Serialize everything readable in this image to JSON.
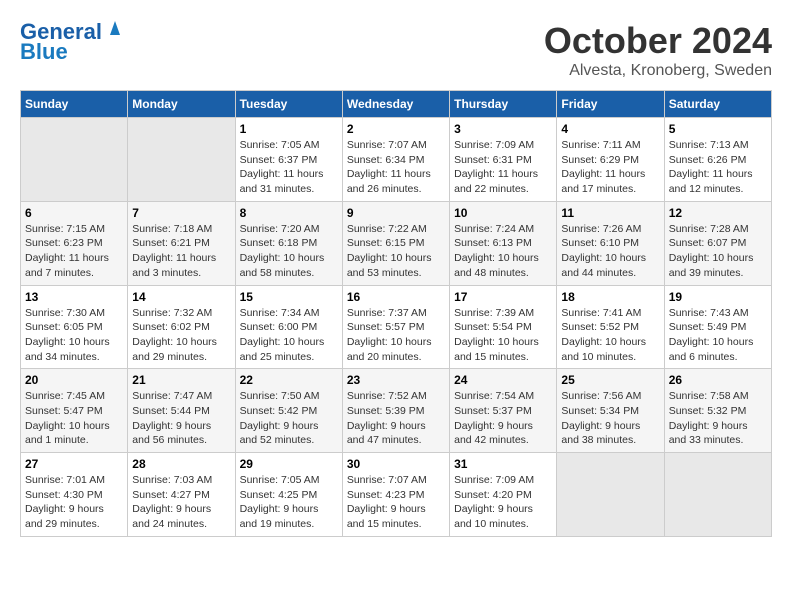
{
  "header": {
    "logo_line1": "General",
    "logo_line2": "Blue",
    "month": "October 2024",
    "location": "Alvesta, Kronoberg, Sweden"
  },
  "weekdays": [
    "Sunday",
    "Monday",
    "Tuesday",
    "Wednesday",
    "Thursday",
    "Friday",
    "Saturday"
  ],
  "weeks": [
    [
      null,
      null,
      {
        "day": 1,
        "sunrise": "7:05 AM",
        "sunset": "6:37 PM",
        "daylight": "11 hours and 31 minutes."
      },
      {
        "day": 2,
        "sunrise": "7:07 AM",
        "sunset": "6:34 PM",
        "daylight": "11 hours and 26 minutes."
      },
      {
        "day": 3,
        "sunrise": "7:09 AM",
        "sunset": "6:31 PM",
        "daylight": "11 hours and 22 minutes."
      },
      {
        "day": 4,
        "sunrise": "7:11 AM",
        "sunset": "6:29 PM",
        "daylight": "11 hours and 17 minutes."
      },
      {
        "day": 5,
        "sunrise": "7:13 AM",
        "sunset": "6:26 PM",
        "daylight": "11 hours and 12 minutes."
      }
    ],
    [
      {
        "day": 6,
        "sunrise": "7:15 AM",
        "sunset": "6:23 PM",
        "daylight": "11 hours and 7 minutes."
      },
      {
        "day": 7,
        "sunrise": "7:18 AM",
        "sunset": "6:21 PM",
        "daylight": "11 hours and 3 minutes."
      },
      {
        "day": 8,
        "sunrise": "7:20 AM",
        "sunset": "6:18 PM",
        "daylight": "10 hours and 58 minutes."
      },
      {
        "day": 9,
        "sunrise": "7:22 AM",
        "sunset": "6:15 PM",
        "daylight": "10 hours and 53 minutes."
      },
      {
        "day": 10,
        "sunrise": "7:24 AM",
        "sunset": "6:13 PM",
        "daylight": "10 hours and 48 minutes."
      },
      {
        "day": 11,
        "sunrise": "7:26 AM",
        "sunset": "6:10 PM",
        "daylight": "10 hours and 44 minutes."
      },
      {
        "day": 12,
        "sunrise": "7:28 AM",
        "sunset": "6:07 PM",
        "daylight": "10 hours and 39 minutes."
      }
    ],
    [
      {
        "day": 13,
        "sunrise": "7:30 AM",
        "sunset": "6:05 PM",
        "daylight": "10 hours and 34 minutes."
      },
      {
        "day": 14,
        "sunrise": "7:32 AM",
        "sunset": "6:02 PM",
        "daylight": "10 hours and 29 minutes."
      },
      {
        "day": 15,
        "sunrise": "7:34 AM",
        "sunset": "6:00 PM",
        "daylight": "10 hours and 25 minutes."
      },
      {
        "day": 16,
        "sunrise": "7:37 AM",
        "sunset": "5:57 PM",
        "daylight": "10 hours and 20 minutes."
      },
      {
        "day": 17,
        "sunrise": "7:39 AM",
        "sunset": "5:54 PM",
        "daylight": "10 hours and 15 minutes."
      },
      {
        "day": 18,
        "sunrise": "7:41 AM",
        "sunset": "5:52 PM",
        "daylight": "10 hours and 10 minutes."
      },
      {
        "day": 19,
        "sunrise": "7:43 AM",
        "sunset": "5:49 PM",
        "daylight": "10 hours and 6 minutes."
      }
    ],
    [
      {
        "day": 20,
        "sunrise": "7:45 AM",
        "sunset": "5:47 PM",
        "daylight": "10 hours and 1 minute."
      },
      {
        "day": 21,
        "sunrise": "7:47 AM",
        "sunset": "5:44 PM",
        "daylight": "9 hours and 56 minutes."
      },
      {
        "day": 22,
        "sunrise": "7:50 AM",
        "sunset": "5:42 PM",
        "daylight": "9 hours and 52 minutes."
      },
      {
        "day": 23,
        "sunrise": "7:52 AM",
        "sunset": "5:39 PM",
        "daylight": "9 hours and 47 minutes."
      },
      {
        "day": 24,
        "sunrise": "7:54 AM",
        "sunset": "5:37 PM",
        "daylight": "9 hours and 42 minutes."
      },
      {
        "day": 25,
        "sunrise": "7:56 AM",
        "sunset": "5:34 PM",
        "daylight": "9 hours and 38 minutes."
      },
      {
        "day": 26,
        "sunrise": "7:58 AM",
        "sunset": "5:32 PM",
        "daylight": "9 hours and 33 minutes."
      }
    ],
    [
      {
        "day": 27,
        "sunrise": "7:01 AM",
        "sunset": "4:30 PM",
        "daylight": "9 hours and 29 minutes."
      },
      {
        "day": 28,
        "sunrise": "7:03 AM",
        "sunset": "4:27 PM",
        "daylight": "9 hours and 24 minutes."
      },
      {
        "day": 29,
        "sunrise": "7:05 AM",
        "sunset": "4:25 PM",
        "daylight": "9 hours and 19 minutes."
      },
      {
        "day": 30,
        "sunrise": "7:07 AM",
        "sunset": "4:23 PM",
        "daylight": "9 hours and 15 minutes."
      },
      {
        "day": 31,
        "sunrise": "7:09 AM",
        "sunset": "4:20 PM",
        "daylight": "9 hours and 10 minutes."
      },
      null,
      null
    ]
  ]
}
